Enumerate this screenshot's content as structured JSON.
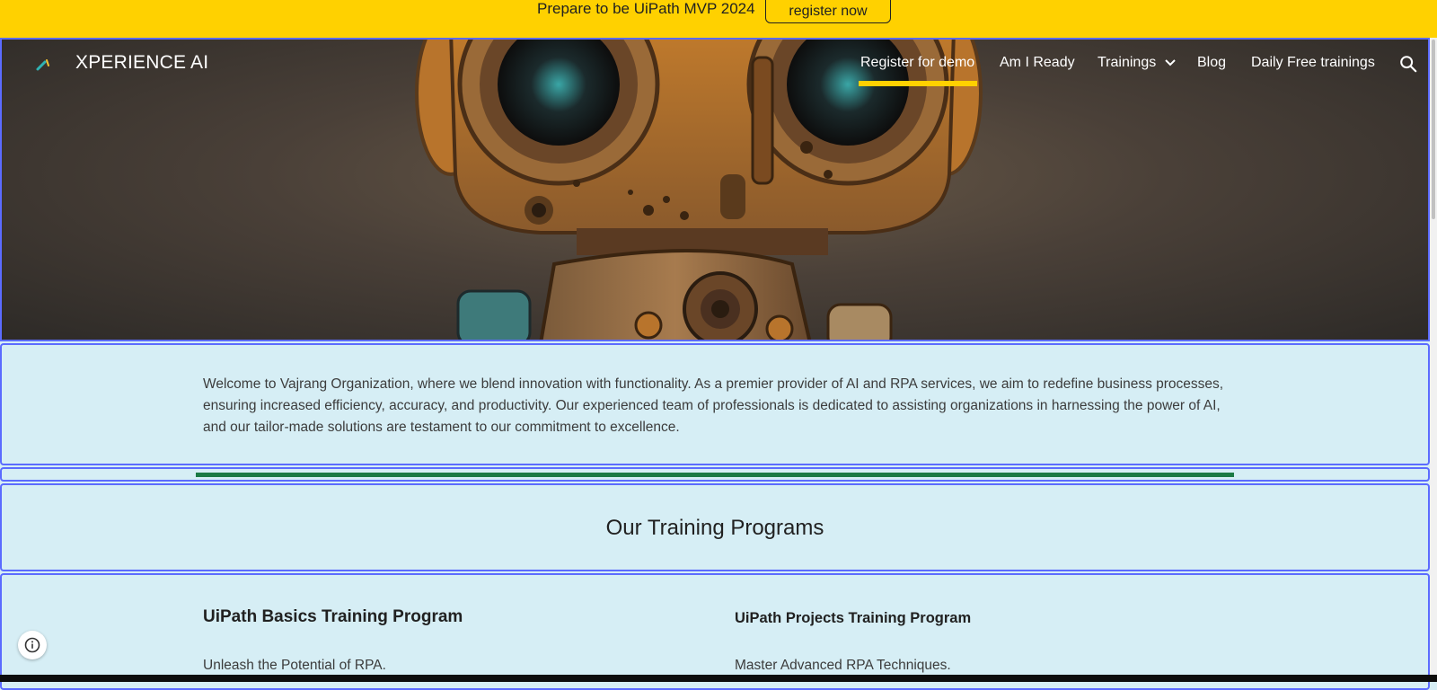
{
  "announcement": {
    "text": "Prepare to be UiPath MVP 2024",
    "button_label": "register now"
  },
  "header": {
    "site_title": "XPERIENCE AI",
    "nav": [
      {
        "label": "Register for demo",
        "active": true
      },
      {
        "label": "Am I Ready"
      },
      {
        "label": "Trainings",
        "has_dropdown": true
      },
      {
        "label": "Blog"
      },
      {
        "label": "Daily Free trainings"
      }
    ],
    "search_icon": "search-icon",
    "active_indicator_color": "#ffd100"
  },
  "intro": {
    "text": "Welcome to Vajrang Organization, where we blend innovation with functionality. As a premier provider of AI and RPA services, we aim to redefine business processes, ensuring increased efficiency, accuracy, and productivity. Our experienced team of professionals is dedicated to assisting organizations in harnessing the power of AI, and our tailor-made solutions are testament to our commitment to excellence."
  },
  "programs": {
    "heading": "Our Training Programs",
    "cards": [
      {
        "title": "UiPath Basics Training Program",
        "description": "Unleash the Potential of RPA."
      },
      {
        "title": "UiPath Projects Training Program",
        "description": "Master Advanced RPA Techniques."
      }
    ]
  },
  "colors": {
    "announcement_bg": "#ffd100",
    "page_bg": "#d6eef5",
    "section_outline": "#5b6bff",
    "divider": "#1b7a44"
  }
}
